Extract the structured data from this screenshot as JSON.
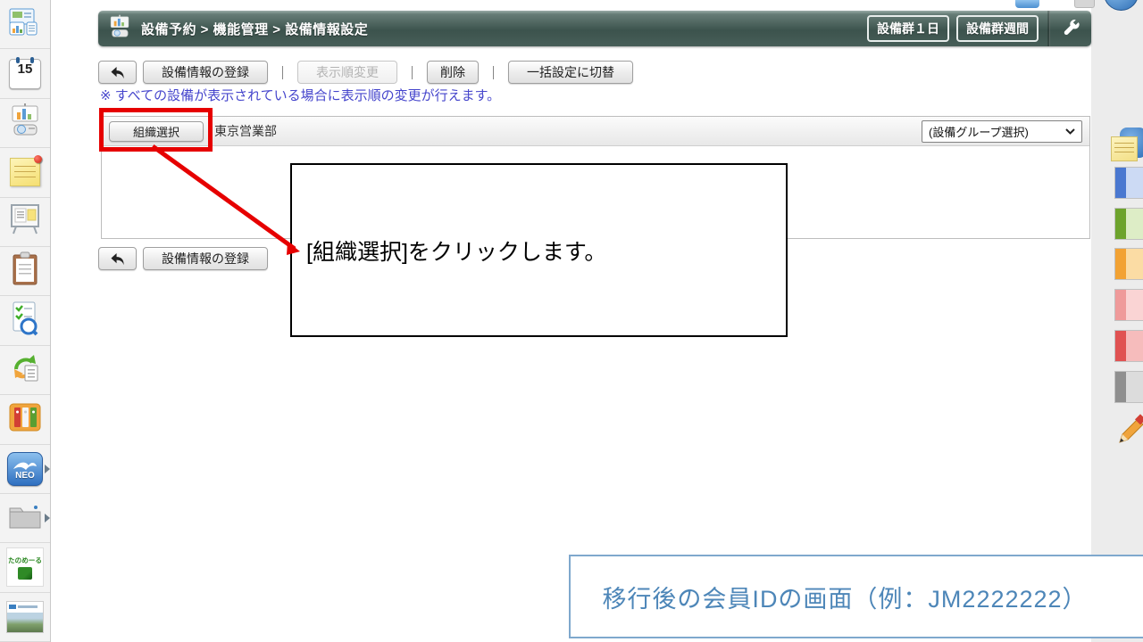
{
  "colors": {
    "header_teal": "#475e58",
    "annotation_red": "#e60000",
    "note_blue": "#4545cc",
    "caption_text_blue": "#4d86b8",
    "caption_border_blue": "#7fa8cd"
  },
  "left_sidebar": {
    "items": [
      {
        "name": "portal",
        "icon": "portal-icon"
      },
      {
        "name": "schedule",
        "icon": "calendar-icon",
        "day": "15"
      },
      {
        "name": "facility-reservation",
        "icon": "facility-icon"
      },
      {
        "name": "memo",
        "icon": "memo-note-icon"
      },
      {
        "name": "bulletin-board",
        "icon": "bulletin-board-icon"
      },
      {
        "name": "todo",
        "icon": "clipboard-icon"
      },
      {
        "name": "survey",
        "icon": "survey-icon"
      },
      {
        "name": "circulation",
        "icon": "circulation-icon"
      },
      {
        "name": "document-binder",
        "icon": "binder-icon"
      },
      {
        "name": "neo-launcher",
        "icon": "neo-icon",
        "label": "NEO"
      },
      {
        "name": "folder",
        "icon": "folder-icon"
      },
      {
        "name": "tanomail-ad",
        "icon": "tanomail-icon",
        "label": "たのめーる"
      },
      {
        "name": "photo-ad",
        "icon": "photo-ad-icon"
      }
    ]
  },
  "header": {
    "title": "設備予約 > 機能管理 > 設備情報設定",
    "icon": "facility-icon",
    "view_buttons": [
      {
        "label": "設備群１日"
      },
      {
        "label": "設備群週間"
      }
    ],
    "settings_icon": "wrench-icon"
  },
  "toolbar": {
    "back_icon": "back-arrow-icon",
    "register_label": "設備情報の登録",
    "reorder_label": "表示順変更",
    "reorder_disabled": true,
    "delete_label": "削除",
    "bulk_label": "一括設定に切替",
    "separator": "｜"
  },
  "note": {
    "text": "※ すべての設備が表示されている場合に表示順の変更が行えます。"
  },
  "panel": {
    "org_select_label": "組織選択",
    "org_name": "東京営業部",
    "group_select_label": "(設備グループ選択)"
  },
  "bottom_toolbar": {
    "back_icon": "back-arrow-icon",
    "register_label": "設備情報の登録"
  },
  "annotations": {
    "callout_text": "[組織選択]をクリックします。",
    "caption_text": "移行後の会員IDの画面（例：JM2222222）"
  },
  "right_strip": {
    "icons": [
      {
        "name": "info-note"
      },
      {
        "name": "color-label-blue",
        "color": "#4a78d0",
        "light": "#ccdaf4"
      },
      {
        "name": "color-label-green",
        "color": "#6da32c",
        "light": "#ddedc6"
      },
      {
        "name": "color-label-orange",
        "color": "#f2a233",
        "light": "#fbdca4"
      },
      {
        "name": "color-label-pink",
        "color": "#ef9a9a",
        "light": "#fad4d4"
      },
      {
        "name": "color-label-red",
        "color": "#e05252",
        "light": "#f6bcbc"
      },
      {
        "name": "color-label-gray",
        "color": "#8f8f8f",
        "light": "#dcdcdc"
      },
      {
        "name": "pencil"
      }
    ]
  }
}
